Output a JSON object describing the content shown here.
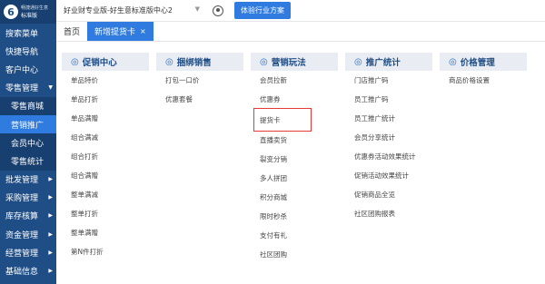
{
  "logo": {
    "mark": "6",
    "line1": "畅捷通好生意",
    "line2": "标准版"
  },
  "sidebar": {
    "items": [
      {
        "label": "搜索菜单",
        "caret": ""
      },
      {
        "label": "快捷导航",
        "caret": ""
      },
      {
        "label": "客户中心",
        "caret": ""
      },
      {
        "label": "零售管理",
        "caret": "▼"
      },
      {
        "label": "零售商城",
        "caret": ""
      },
      {
        "label": "营销推广",
        "caret": ""
      },
      {
        "label": "会员中心",
        "caret": ""
      },
      {
        "label": "零售统计",
        "caret": ""
      },
      {
        "label": "批发管理",
        "caret": "▶"
      },
      {
        "label": "采购管理",
        "caret": "▶"
      },
      {
        "label": "库存核算",
        "caret": "▶"
      },
      {
        "label": "资金管理",
        "caret": "▶"
      },
      {
        "label": "经营管理",
        "caret": "▶"
      },
      {
        "label": "基础信息",
        "caret": "▶"
      }
    ]
  },
  "topbar": {
    "store": "好业财专业版-好生意标准版中心2",
    "trial_button": "体验行业方案"
  },
  "tabs": {
    "home": "首页",
    "active": "新增提货卡",
    "close": "×"
  },
  "menu": {
    "columns": [
      {
        "icon": "◎",
        "title": "促销中心",
        "items": [
          "单品特价",
          "单品打折",
          "单品满赠",
          "组合满减",
          "组合打折",
          "组合满赠",
          "整单满减",
          "整单打折",
          "整单满赠",
          "第N件打折"
        ]
      },
      {
        "icon": "◎",
        "title": "捆绑销售",
        "items": [
          "打包一口价",
          "优惠套餐"
        ]
      },
      {
        "icon": "◎",
        "title": "营销玩法",
        "items": [
          "会员拉新",
          "优惠券",
          "提货卡",
          "直播卖货",
          "裂变分销",
          "多人拼团",
          "积分商城",
          "限时秒杀",
          "支付有礼",
          "社区团购"
        ]
      },
      {
        "icon": "◎",
        "title": "推广统计",
        "items": [
          "门店推广码",
          "员工推广码",
          "员工推广统计",
          "会员分享统计",
          "优惠券活动效果统计",
          "促销活动效果统计",
          "促销商品全览",
          "社区团购报表"
        ]
      },
      {
        "icon": "◎",
        "title": "价格管理",
        "items": [
          "商品价格设置"
        ]
      }
    ]
  },
  "colors": {
    "sidebar": "#1f4e86",
    "accent": "#2f7bdf",
    "highlight_border": "#e53935"
  }
}
